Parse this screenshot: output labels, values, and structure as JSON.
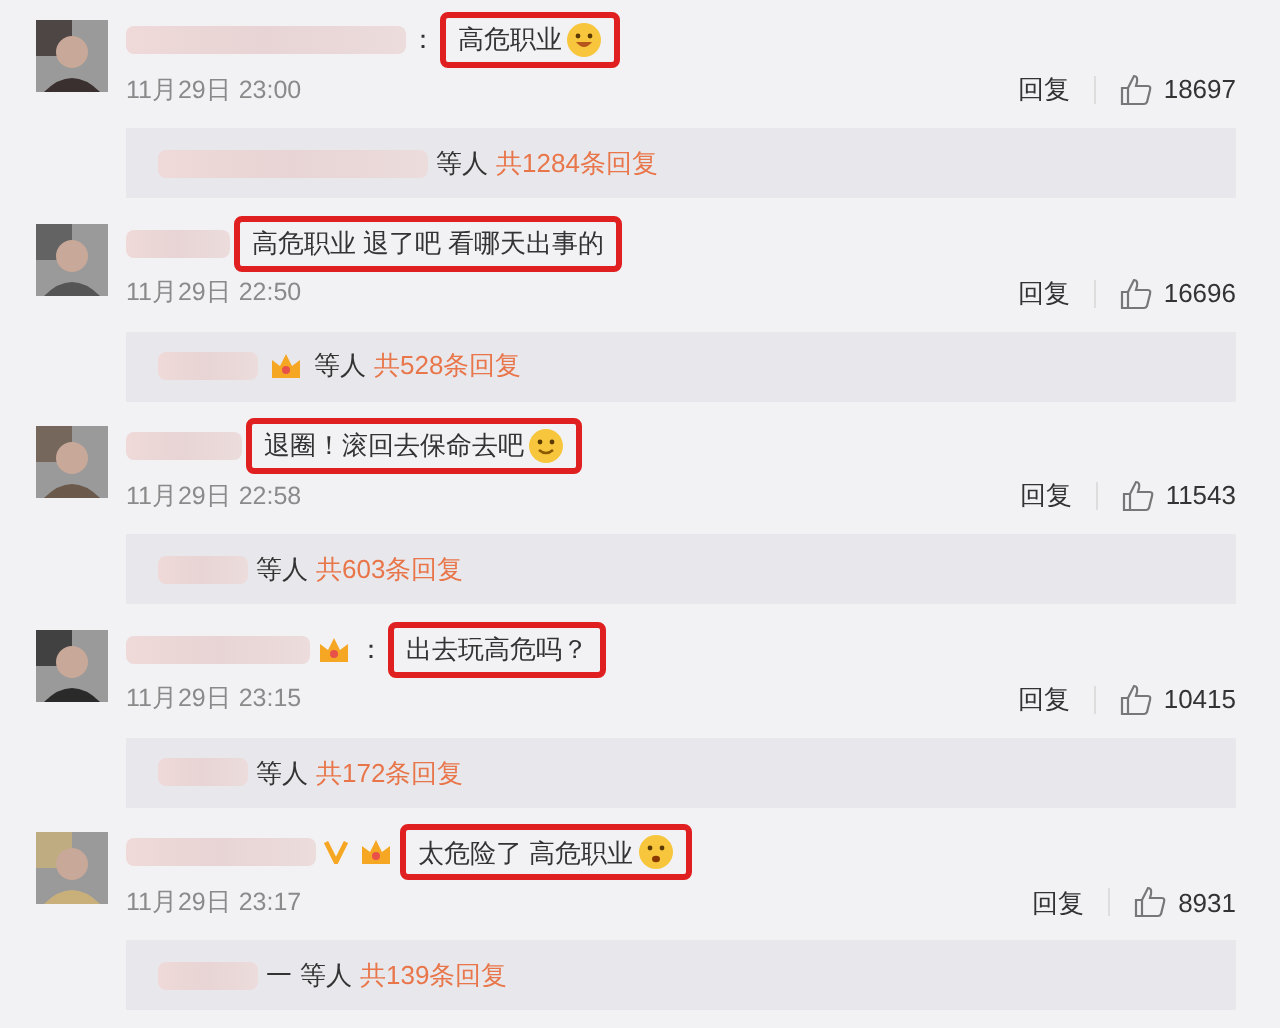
{
  "comments": [
    {
      "colon": "：",
      "text": "高危职业",
      "emoji": {
        "kind": "grin"
      },
      "time": "11月29日 23:00",
      "reply_label": "回复",
      "likes": "18697",
      "thread": {
        "others": "等人",
        "count": "共1284条回复"
      }
    },
    {
      "text": "高危职业 退了吧 看哪天出事的",
      "time": "11月29日 22:50",
      "reply_label": "回复",
      "likes": "16696",
      "thread": {
        "badges": [
          {
            "kind": "crown"
          }
        ],
        "others": "等人",
        "count": "共528条回复"
      }
    },
    {
      "text": "退圈！滚回去保命去吧",
      "emoji": {
        "kind": "smile"
      },
      "time": "11月29日 22:58",
      "reply_label": "回复",
      "likes": "11543",
      "thread": {
        "others": "等人",
        "count": "共603条回复"
      }
    },
    {
      "badges": [
        {
          "kind": "crown"
        }
      ],
      "colon": "：",
      "text": "出去玩高危吗？",
      "time": "11月29日 23:15",
      "reply_label": "回复",
      "likes": "10415",
      "thread": {
        "others": "等人",
        "count": "共172条回复"
      }
    },
    {
      "badges": [
        {
          "kind": "vip"
        },
        {
          "kind": "crown"
        }
      ],
      "text": "太危险了 高危职业",
      "emoji": {
        "kind": "worried"
      },
      "time": "11月29日 23:17",
      "reply_label": "回复",
      "likes": "8931",
      "thread": {
        "suffix": "一",
        "others": "等人",
        "count": "共139条回复"
      }
    }
  ]
}
